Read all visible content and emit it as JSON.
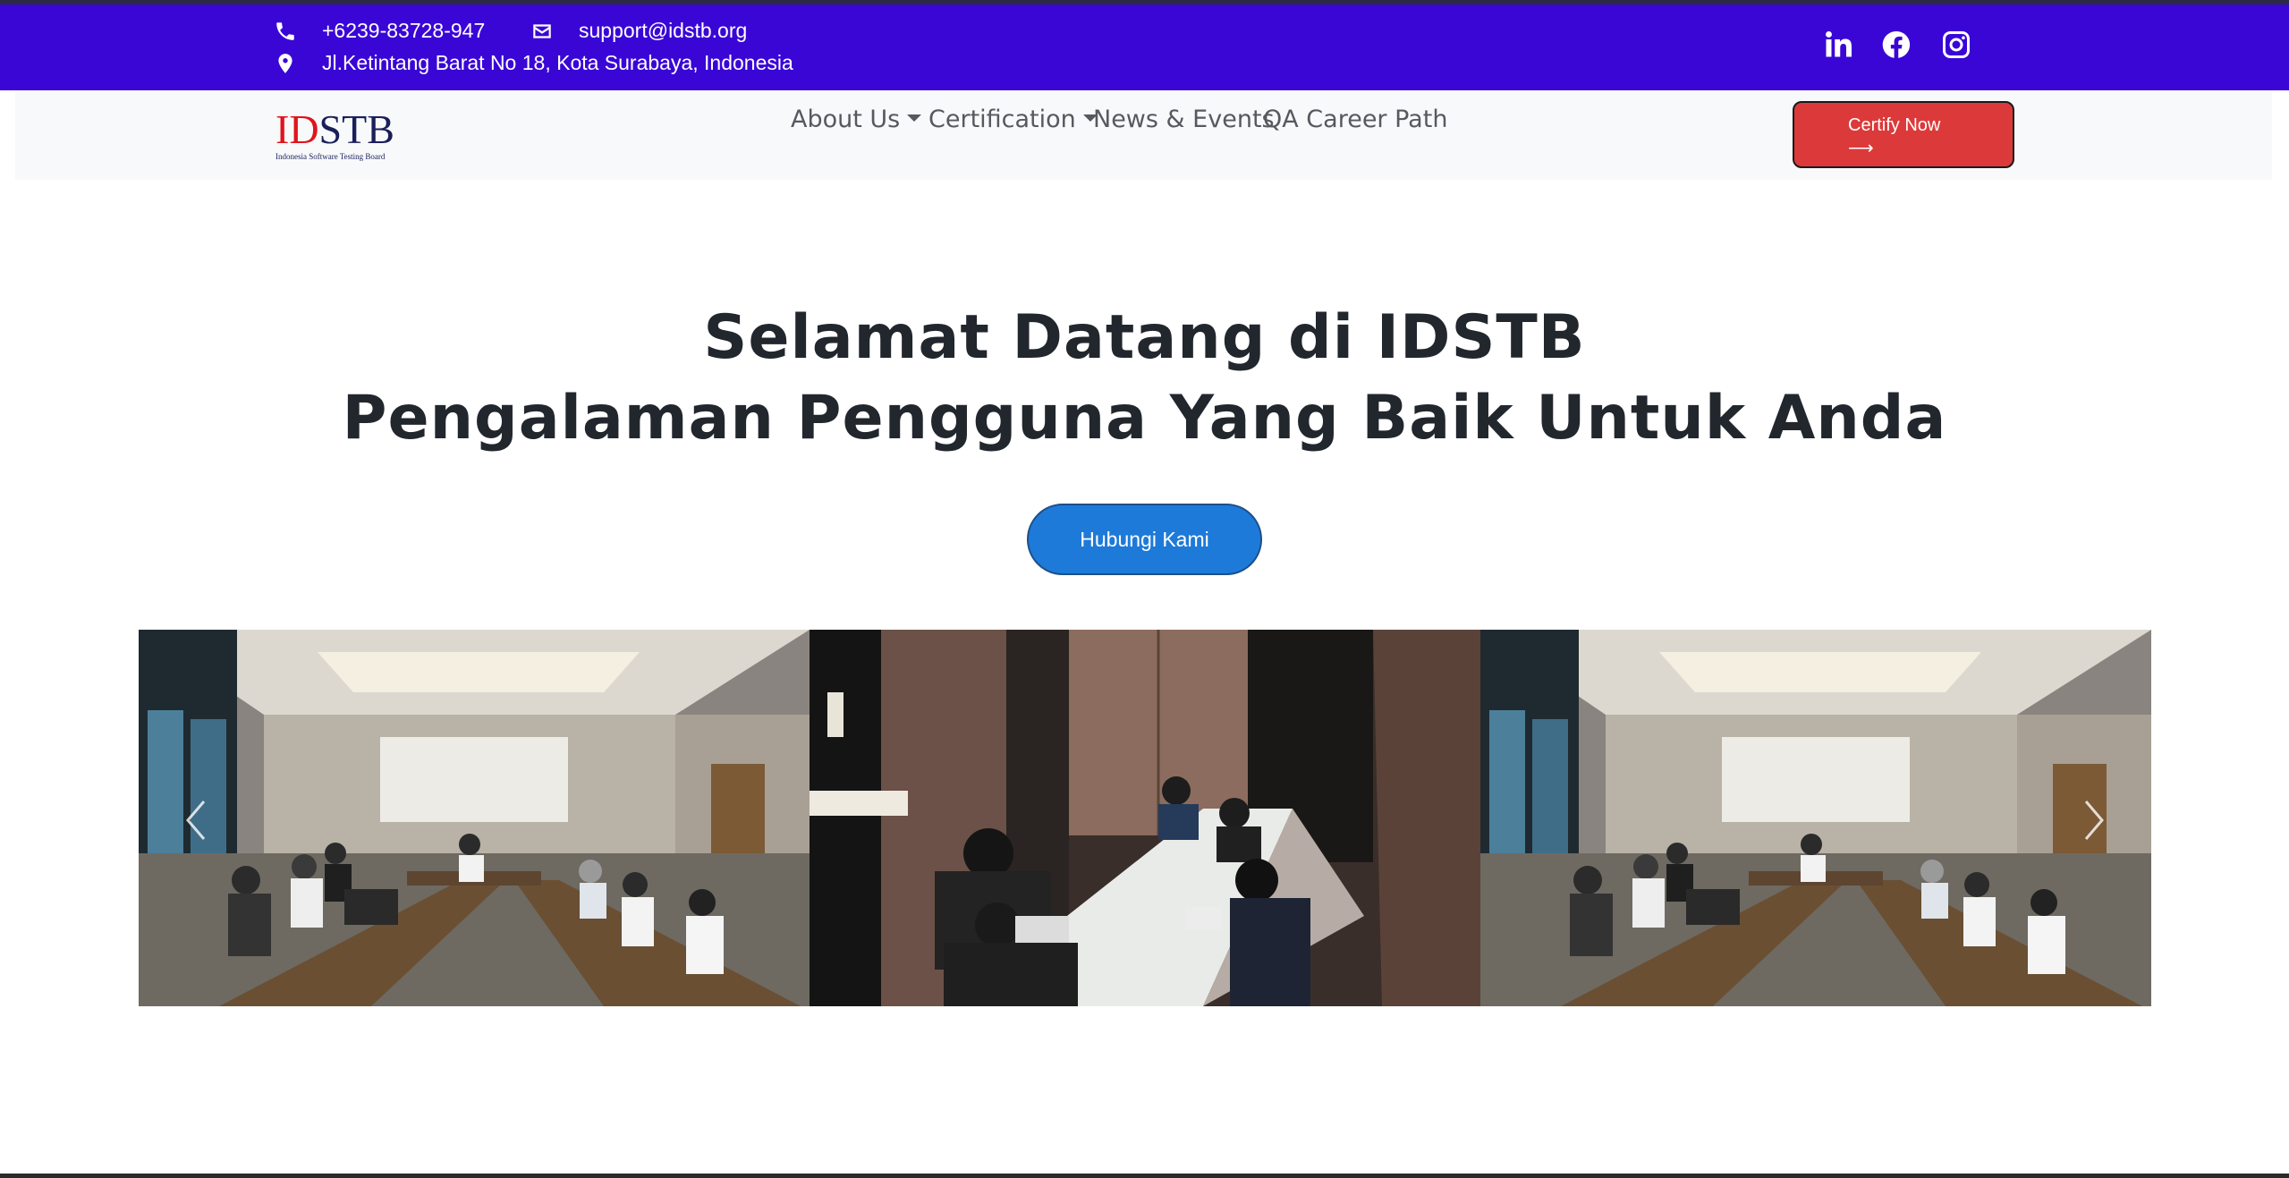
{
  "topbar": {
    "phone": "+6239-83728-947",
    "email": "support@idstb.org",
    "address": "Jl.Ketintang Barat No 18, Kota Surabaya, Indonesia",
    "social": [
      "linkedin-icon",
      "facebook-icon",
      "instagram-icon"
    ],
    "background": "#3a06d6"
  },
  "navbar": {
    "logo_id": "ID",
    "logo_stb": "STB",
    "logo_sub": "Indonesia Software Testing Board",
    "items": [
      "About Us",
      "Certification",
      "News & Events",
      "QA Career Path"
    ],
    "certify_label": "Certify Now",
    "certify_arrow": "⟶",
    "certify_color": "#dc3a3a"
  },
  "hero": {
    "title_line1": "Selamat Datang di IDSTB",
    "title_line2": "Pengalaman Pengguna Yang Baik Untuk Anda",
    "cta_label": "Hubungi Kami",
    "cta_color": "#1e7ad8"
  },
  "carousel": {
    "slides": [
      "meeting-room-photo",
      "exam-table-photo",
      "meeting-room-photo"
    ],
    "prev_icon": "chevron-left-icon",
    "next_icon": "chevron-right-icon"
  }
}
